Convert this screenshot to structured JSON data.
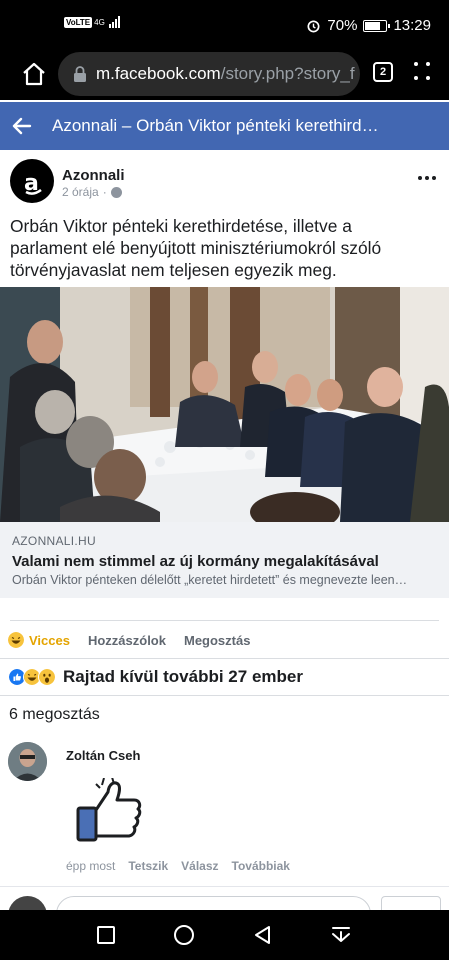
{
  "status_bar": {
    "volte": "VoLTE",
    "network": "4G",
    "battery": "70%",
    "time": "13:29"
  },
  "browser": {
    "url_host": "m.facebook.com",
    "url_path": "/story.php?story_f",
    "tab_count": "2"
  },
  "header": {
    "title": "Azonnali – Orbán Viktor pénteki kerethird…"
  },
  "post": {
    "page_name": "Azonnali",
    "time": "2 órája",
    "separator": "·",
    "text": "Orbán Viktor pénteki kerethirdetése, illetve a parlament elé benyújtott minisztériumokról szóló törvényjavaslat nem teljesen egyezik meg."
  },
  "link_preview": {
    "domain": "AZONNALI.HU",
    "title": "Valami nem stimmel az új kormány megalakításával",
    "description": "Orbán Viktor pénteken délelőtt „keretet hirdetett” és megnevezte leen…"
  },
  "actions": {
    "reaction_label": "Vicces",
    "comment_label": "Hozzászólok",
    "share_label": "Megosztás"
  },
  "reactions_summary": {
    "text": "Rajtad kívül további 27 ember"
  },
  "shares": {
    "text": "6 megosztás"
  },
  "comment": {
    "author": "Zoltán Cseh",
    "time": "épp most",
    "like_label": "Tetszik",
    "reply_label": "Válasz",
    "more_label": "Továbbiak"
  },
  "colors": {
    "facebook_blue": "#4267b2",
    "haha_yellow": "#e4a400",
    "link_bg": "#f0f2f5"
  },
  "icons": [
    "home-icon",
    "lock-icon",
    "tabs-icon",
    "menu-icon",
    "back-arrow-icon",
    "globe-icon",
    "more-icon",
    "haha-icon",
    "like-icon",
    "wow-icon",
    "thumbs-up-sticker-icon",
    "square-nav-icon",
    "circle-nav-icon",
    "triangle-nav-icon",
    "download-nav-icon"
  ]
}
